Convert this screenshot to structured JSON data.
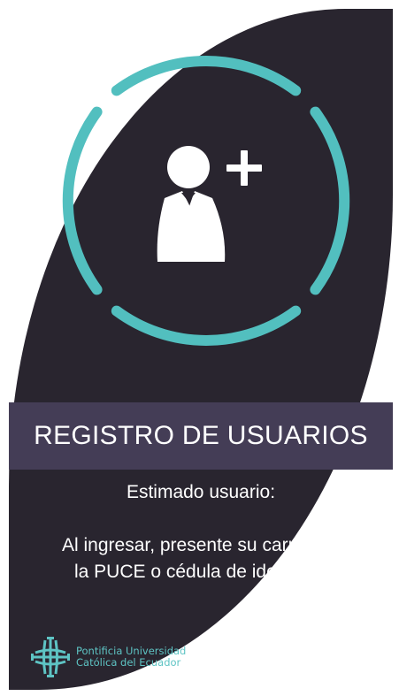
{
  "colors": {
    "background": "#29252f",
    "accent": "#52bfbf",
    "band": "#443d56",
    "text": "#ffffff"
  },
  "hero": {
    "icon": "add-user-icon"
  },
  "title": "REGISTRO DE USUARIOS",
  "greeting": "Estimado usuario:",
  "instruction": {
    "line1": "Al ingresar, presente su carnet de",
    "line2": "la PUCE o cédula de identidad"
  },
  "logo": {
    "icon": "puce-cross-logo",
    "line1": "Pontificia Universidad",
    "line2": "Católica del Ecuador"
  }
}
